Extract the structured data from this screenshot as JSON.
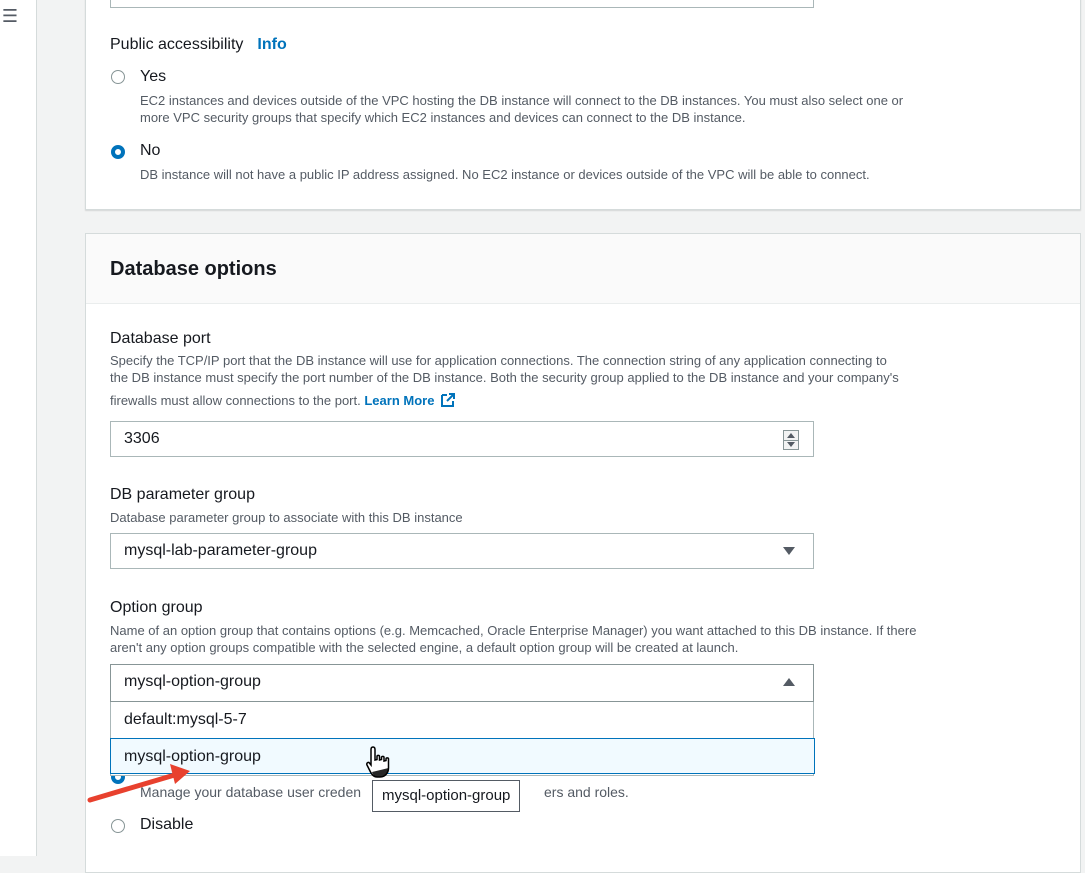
{
  "nav": {
    "menu_icon": "hamburger-icon"
  },
  "public_access": {
    "title": "Public accessibility",
    "info": "Info",
    "yes_label": "Yes",
    "yes_desc_1": "EC2 instances and devices outside of the VPC hosting the DB instance will connect to the DB instances. You must also select one or",
    "yes_desc_2": "more VPC security groups that specify which EC2 instances and devices can connect to the DB instance.",
    "no_label": "No",
    "no_desc": "DB instance will not have a public IP address assigned. No EC2 instance or devices outside of the VPC will be able to connect.",
    "selected": "No"
  },
  "db_options": {
    "title": "Database options",
    "port": {
      "label": "Database port",
      "desc_1": "Specify the TCP/IP port that the DB instance will use for application connections. The connection string of any application connecting to",
      "desc_2": "the DB instance must specify the port number of the DB instance. Both the security group applied to the DB instance and your company's",
      "desc_3": "firewalls must allow connections to the port.",
      "learn_more": "Learn More",
      "value": "3306"
    },
    "param_group": {
      "label": "DB parameter group",
      "desc": "Database parameter group to associate with this DB instance",
      "value": "mysql-lab-parameter-group"
    },
    "option_group": {
      "label": "Option group",
      "desc_1": "Name of an option group that contains options (e.g. Memcached, Oracle Enterprise Manager) you want attached to this DB instance. If there",
      "desc_2": "aren't any option groups compatible with the selected engine, a default option group will be created at launch.",
      "value": "mysql-option-group",
      "options": [
        "default:mysql-5-7",
        "mysql-option-group"
      ],
      "tooltip": "mysql-option-group"
    },
    "iam": {
      "partial_desc_left": "Manage your database user creden",
      "partial_desc_right": "ers and roles.",
      "disable_label": "Disable"
    }
  },
  "colors": {
    "accent": "#0073bb",
    "annotation_arrow": "#e8412e"
  }
}
